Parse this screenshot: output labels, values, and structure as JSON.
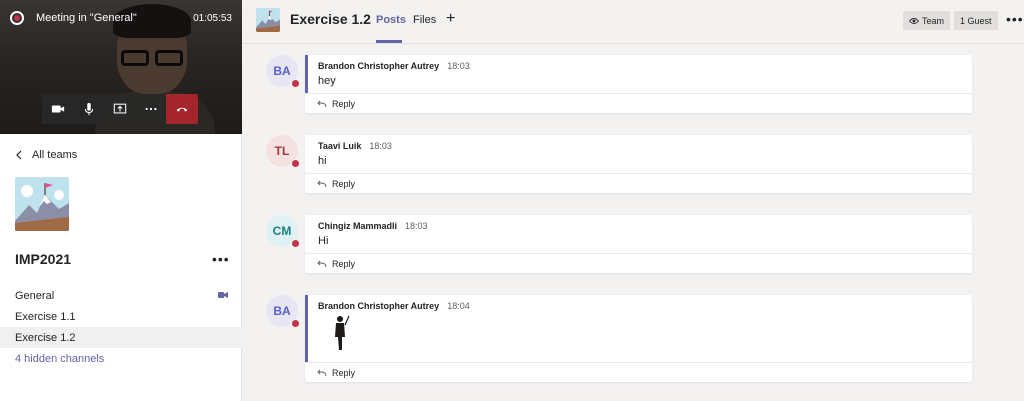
{
  "call": {
    "title": "Meeting in \"General\"",
    "timer": "01:05:53"
  },
  "sidebar": {
    "back_label": "All teams",
    "team_name": "IMP2021",
    "more": "•••",
    "channels": [
      {
        "label": "General"
      },
      {
        "label": "Exercise 1.1"
      },
      {
        "label": "Exercise 1.2"
      }
    ],
    "hidden_channels": "4 hidden channels"
  },
  "header": {
    "title": "Exercise 1.2",
    "tabs": [
      {
        "label": "Posts"
      },
      {
        "label": "Files"
      }
    ],
    "add_tab": "+",
    "team_pill": "Team",
    "guest_pill": "1 Guest",
    "more": "•••"
  },
  "posts": [
    {
      "initials": "BA",
      "author": "Brandon Christopher Autrey",
      "time": "18:03",
      "text": "hey",
      "reply": "Reply",
      "avatar_bg": "#e8e6f4",
      "avatar_fg": "#5b5fc7"
    },
    {
      "initials": "TL",
      "author": "Taavi Luik",
      "time": "18:03",
      "text": "hi",
      "reply": "Reply",
      "avatar_bg": "#f6e1e1",
      "avatar_fg": "#a4373a"
    },
    {
      "initials": "CM",
      "author": "Chingiz Mammadli",
      "time": "18:03",
      "text": "Hi",
      "reply": "Reply",
      "avatar_bg": "#dff1f2",
      "avatar_fg": "#1b7f86"
    },
    {
      "initials": "BA",
      "author": "Brandon Christopher Autrey",
      "time": "18:04",
      "text": "",
      "reply": "Reply",
      "avatar_bg": "#e8e6f4",
      "avatar_fg": "#5b5fc7"
    }
  ],
  "colors": {
    "accent": "#6264a7",
    "hangup": "#a4262c",
    "status_busy": "#c4314b"
  }
}
